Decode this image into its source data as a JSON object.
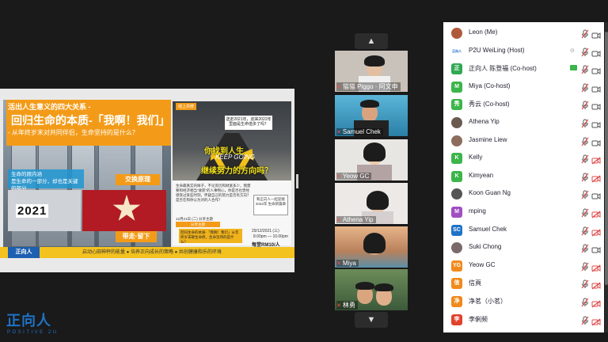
{
  "slide": {
    "header": "活出人生意义的四大关系 -",
    "main_title": "回归生命的本质-「我啊！我们」",
    "subtitle": "- 从年终岁末对共同伴侣，生命坚持的是什么？",
    "blue_text_1": "生命的原内涵",
    "blue_text_2": "是生命的一部分，却也是关键的部分",
    "exchange_label": "交换原理",
    "year_text": "2021",
    "takeaway_label": "带走·留下",
    "footer_logo": "正向人",
    "footer_text": "启动心田神秤的能量 ● 培养正向成长的策略 ● 共创健康和乐的环境",
    "poster_tag": "线上共修",
    "poster_question": "送走2021年，迎来2022年 里面是生命值多了吗？",
    "poster_line1": "你找到人生",
    "poster_line2": "KEEP GOING",
    "poster_line3": "继续努力的方向吗？",
    "info_text": "生命最真实的样子，不论资历和财富多少，我需要和经济相当“收获”的人事物心，你是否也曾经感受过某些时刻，怀疑自己的努力是否有方向？是否在和你认为对的人合作？",
    "info_box": "和正向人一起迎接2022年 生命新篇章",
    "share_line": "12月21日 (二) 分享主题",
    "share_title": "分享主题",
    "share_box": "回归生命的本质-「我啊！我们」从年终岁末聊生命修，生命坚持的是什么？",
    "date_text": "29/12/2021 (三)",
    "time_text": "8.00pm — 10.00pm",
    "price_text": "每堂RM10/人"
  },
  "gallery": {
    "up_icon": "chevron-up-icon",
    "down_icon": "chevron-down-icon",
    "up_glyph": "▲",
    "down_glyph": "▼",
    "tiles": [
      {
        "label": "猫猫 Piggo · 阿文申"
      },
      {
        "label": "Samuel Chek"
      },
      {
        "label": "Yeow GC"
      },
      {
        "label": "Athena Yip"
      },
      {
        "label": "Miya"
      },
      {
        "label": "林勇"
      }
    ]
  },
  "participants": [
    {
      "name": "Leon (Me)",
      "avatar": "",
      "color": "#b05a3c",
      "photo": true
    },
    {
      "name": "P2U WeiLing (Host)",
      "avatar": "正向人",
      "color": "#1e73c8",
      "logo": true
    },
    {
      "name": "正向人 陈登福 (Co-host)",
      "avatar": "正",
      "color": "#31a852"
    },
    {
      "name": "Miya (Co-host)",
      "avatar": "M",
      "color": "#3cb54a"
    },
    {
      "name": "秀云 (Co-host)",
      "avatar": "秀",
      "color": "#3cb54a"
    },
    {
      "name": "Athena Yip",
      "avatar": "",
      "color": "#6b5a50",
      "photo": true
    },
    {
      "name": "Jasmine Liew",
      "avatar": "",
      "color": "#8c6c5c",
      "photo": true
    },
    {
      "name": "Kelly",
      "avatar": "K",
      "color": "#3cb54a"
    },
    {
      "name": "Kimyean",
      "avatar": "K",
      "color": "#3cb54a"
    },
    {
      "name": "Koon Guan Ng",
      "avatar": "",
      "color": "#555",
      "photo": true
    },
    {
      "name": "mping",
      "avatar": "M",
      "color": "#a04fc2"
    },
    {
      "name": "Samuel Chek",
      "avatar": "SC",
      "color": "#1e73c8"
    },
    {
      "name": "Suki Chong",
      "avatar": "",
      "color": "#7a6a6a",
      "photo": true
    },
    {
      "name": "Yeow GC",
      "avatar": "YG",
      "color": "#f08a1c"
    },
    {
      "name": "信頁",
      "avatar": "信",
      "color": "#f08a1c"
    },
    {
      "name": "净茗（小茗）",
      "avatar": "净",
      "color": "#f08a1c"
    },
    {
      "name": "李俐频",
      "avatar": "李",
      "color": "#e0422b"
    }
  ],
  "watermark": {
    "logo": "正向人",
    "sub": "POSITIVE 2U"
  },
  "colors": {
    "muted_red": "#e04b4b",
    "share_green": "#3cb54a",
    "brand_blue": "#1e73c8",
    "slide_orange": "#f39b18"
  }
}
